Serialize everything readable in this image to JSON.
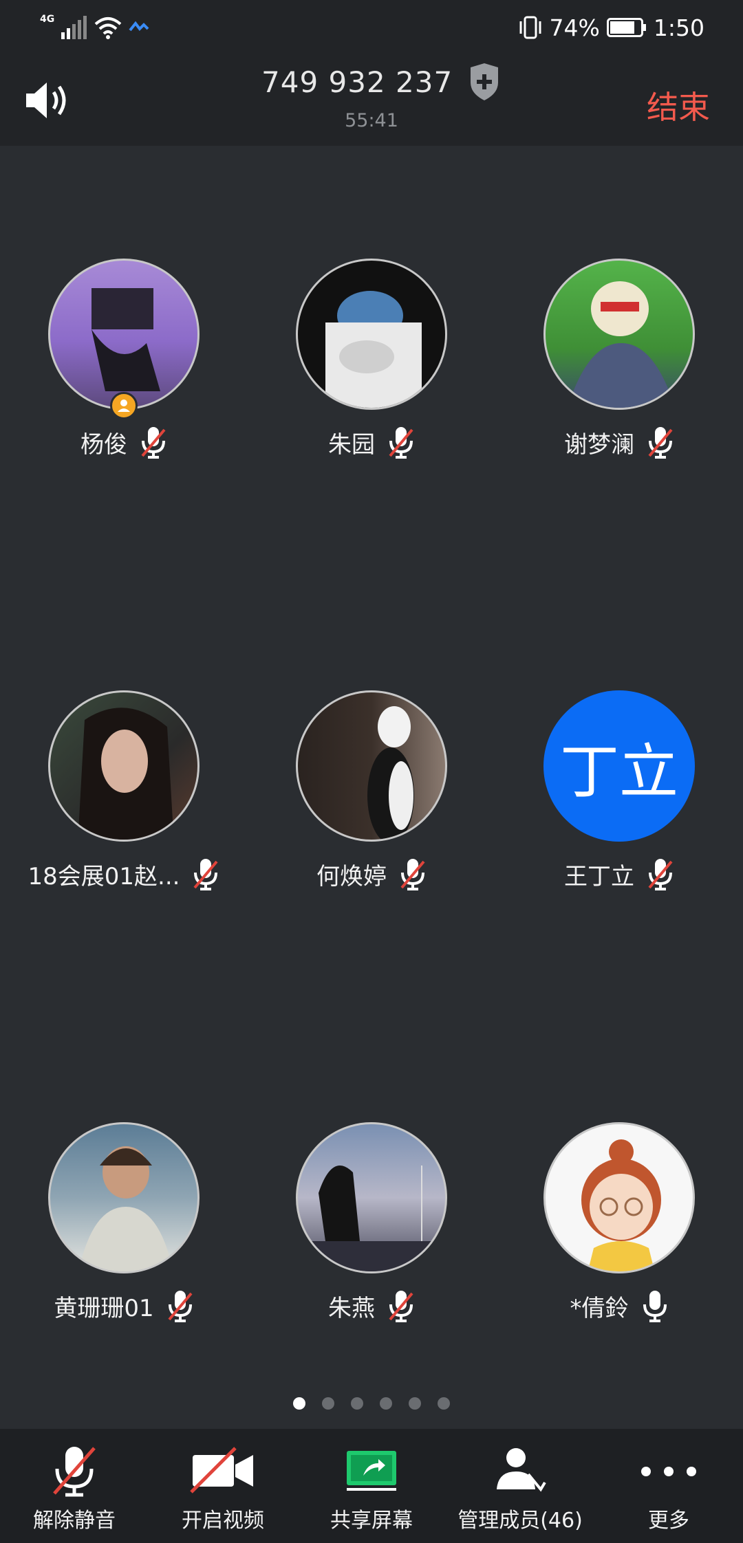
{
  "status_bar": {
    "network": "4G",
    "battery": "74%",
    "time": "1:50"
  },
  "header": {
    "meeting_id": "749 932 237",
    "duration": "55:41",
    "end_label": "结束"
  },
  "participants": [
    {
      "name": "杨俊",
      "avatar": "photo",
      "muted": true,
      "host": true
    },
    {
      "name": "朱园",
      "avatar": "photo",
      "muted": true
    },
    {
      "name": "谢梦澜",
      "avatar": "photo",
      "muted": true
    },
    {
      "name": "18会展01赵...",
      "avatar": "photo",
      "muted": true
    },
    {
      "name": "何焕婷",
      "avatar": "photo",
      "muted": true
    },
    {
      "name": "王丁立",
      "avatar": "letter",
      "avatar_text": "丁立",
      "muted": true
    },
    {
      "name": "黄珊珊01",
      "avatar": "photo",
      "muted": true
    },
    {
      "name": "朱燕",
      "avatar": "photo",
      "muted": true
    },
    {
      "name": "*倩鈴",
      "avatar": "photo",
      "muted": false
    }
  ],
  "pager": {
    "pages": 6,
    "current": 1
  },
  "toolbar": {
    "unmute": "解除静音",
    "start_video": "开启视频",
    "share_screen": "共享屏幕",
    "manage_members": "管理成员(46)",
    "more": "更多"
  },
  "colors": {
    "end": "#f35a4d",
    "avatar_letter_bg": "#0b6cf5",
    "share": "#1ec96d",
    "mute_slash": "#e0443b"
  }
}
